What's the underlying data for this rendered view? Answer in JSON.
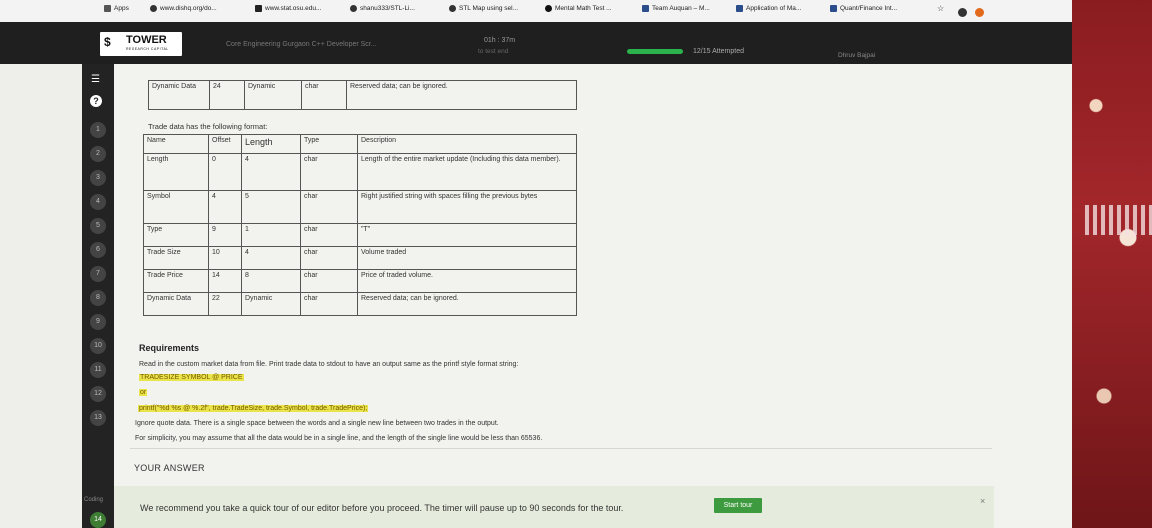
{
  "browser": {
    "bookmarks": [
      {
        "label": "Apps"
      },
      {
        "label": "www.dishq.org/do..."
      },
      {
        "label": "www.stat.osu.edu..."
      },
      {
        "label": "shanu333/STL-Li..."
      },
      {
        "label": "STL Map using sel..."
      },
      {
        "label": "Mental Math Test ..."
      },
      {
        "label": "Team Auquan – M..."
      },
      {
        "label": "Application of Ma..."
      },
      {
        "label": "Quant/Finance Int..."
      }
    ],
    "more": "»"
  },
  "header": {
    "logo_name": "TOWER",
    "logo_sub": "RESEARCH CAPITAL",
    "test_title": "Core Engineering Gurgaon C++ Developer Scr...",
    "timer": "01h : 37m",
    "timer_sub": "to test end",
    "attempted": "12/15 Attempted",
    "user": "Dhruv Bajpai"
  },
  "rail": {
    "menu_icon": "menu-icon",
    "help": "?",
    "numbers": [
      "1",
      "2",
      "3",
      "4",
      "5",
      "6",
      "7",
      "8",
      "9",
      "10",
      "11",
      "12",
      "13",
      "14"
    ],
    "coding_label": "Coding",
    "active": "14"
  },
  "top_table": {
    "rows": [
      [
        "Dynamic Data",
        "24",
        "Dynamic",
        "char",
        "Reserved data; can be ignored."
      ]
    ]
  },
  "trade_caption": "Trade data has the following format:",
  "trade_table": {
    "headers": [
      "Name",
      "Offset",
      "Length",
      "Type",
      "Description"
    ],
    "rows": [
      [
        "Length",
        "0",
        "4",
        "char",
        "Length of the entire market update (Including this data member)."
      ],
      [
        "Symbol",
        "4",
        "5",
        "char",
        "Right justified string with spaces filling the previous bytes"
      ],
      [
        "Type",
        "9",
        "1",
        "char",
        "\"T\""
      ],
      [
        "Trade Size",
        "10",
        "4",
        "char",
        "Volume traded"
      ],
      [
        "Trade Price",
        "14",
        "8",
        "char",
        "Price of traded volume."
      ],
      [
        "Dynamic Data",
        "22",
        "Dynamic",
        "char",
        "Reserved data; can be ignored."
      ]
    ]
  },
  "requirements": {
    "title": "Requirements",
    "line1": "Read in the custom market data from file. Print trade data to stdout to have an output same as the printf style format string:",
    "format": "TRADESIZE SYMBOL @ PRICE",
    "or": "or",
    "printf": "printf(\"%d %s @ %.2f\", trade.TradeSize, trade.Symbol, trade.TradePrice);",
    "line2": "Ignore quote data. There is a single space between the words and a single new line between two trades in the output.",
    "line3": "For simplicity, you may assume that all the data would be in a single line, and the length of the single line would be less than 65536."
  },
  "answer_label": "YOUR ANSWER",
  "tour_banner": {
    "text": "We recommend you take a quick tour of our editor before you proceed. The timer will pause up to 90 seconds for the tour.",
    "button": "Start tour",
    "close": "×"
  },
  "colors": {
    "accent_green": "#3d9a3e",
    "highlight": "#e8e44a",
    "header_bg": "#1f1f1f"
  }
}
